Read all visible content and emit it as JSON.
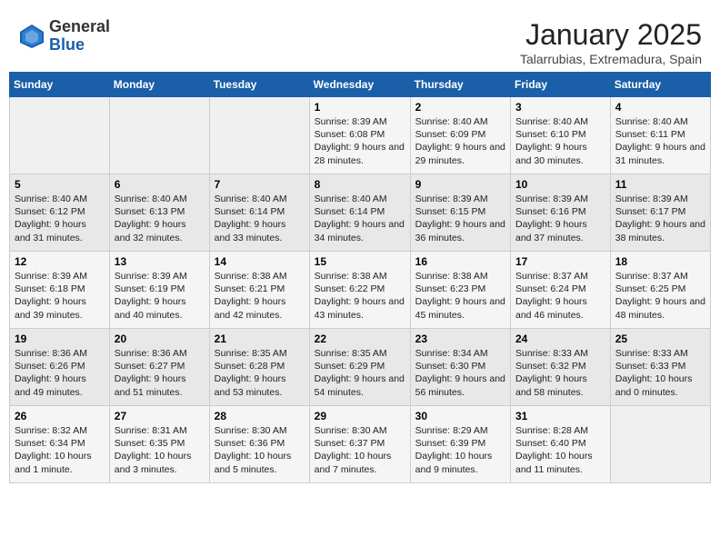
{
  "logo": {
    "general": "General",
    "blue": "Blue"
  },
  "title": "January 2025",
  "location": "Talarrubias, Extremadura, Spain",
  "weekdays": [
    "Sunday",
    "Monday",
    "Tuesday",
    "Wednesday",
    "Thursday",
    "Friday",
    "Saturday"
  ],
  "weeks": [
    [
      {
        "day": "",
        "info": ""
      },
      {
        "day": "",
        "info": ""
      },
      {
        "day": "",
        "info": ""
      },
      {
        "day": "1",
        "info": "Sunrise: 8:39 AM\nSunset: 6:08 PM\nDaylight: 9 hours and 28 minutes."
      },
      {
        "day": "2",
        "info": "Sunrise: 8:40 AM\nSunset: 6:09 PM\nDaylight: 9 hours and 29 minutes."
      },
      {
        "day": "3",
        "info": "Sunrise: 8:40 AM\nSunset: 6:10 PM\nDaylight: 9 hours and 30 minutes."
      },
      {
        "day": "4",
        "info": "Sunrise: 8:40 AM\nSunset: 6:11 PM\nDaylight: 9 hours and 31 minutes."
      }
    ],
    [
      {
        "day": "5",
        "info": "Sunrise: 8:40 AM\nSunset: 6:12 PM\nDaylight: 9 hours and 31 minutes."
      },
      {
        "day": "6",
        "info": "Sunrise: 8:40 AM\nSunset: 6:13 PM\nDaylight: 9 hours and 32 minutes."
      },
      {
        "day": "7",
        "info": "Sunrise: 8:40 AM\nSunset: 6:14 PM\nDaylight: 9 hours and 33 minutes."
      },
      {
        "day": "8",
        "info": "Sunrise: 8:40 AM\nSunset: 6:14 PM\nDaylight: 9 hours and 34 minutes."
      },
      {
        "day": "9",
        "info": "Sunrise: 8:39 AM\nSunset: 6:15 PM\nDaylight: 9 hours and 36 minutes."
      },
      {
        "day": "10",
        "info": "Sunrise: 8:39 AM\nSunset: 6:16 PM\nDaylight: 9 hours and 37 minutes."
      },
      {
        "day": "11",
        "info": "Sunrise: 8:39 AM\nSunset: 6:17 PM\nDaylight: 9 hours and 38 minutes."
      }
    ],
    [
      {
        "day": "12",
        "info": "Sunrise: 8:39 AM\nSunset: 6:18 PM\nDaylight: 9 hours and 39 minutes."
      },
      {
        "day": "13",
        "info": "Sunrise: 8:39 AM\nSunset: 6:19 PM\nDaylight: 9 hours and 40 minutes."
      },
      {
        "day": "14",
        "info": "Sunrise: 8:38 AM\nSunset: 6:21 PM\nDaylight: 9 hours and 42 minutes."
      },
      {
        "day": "15",
        "info": "Sunrise: 8:38 AM\nSunset: 6:22 PM\nDaylight: 9 hours and 43 minutes."
      },
      {
        "day": "16",
        "info": "Sunrise: 8:38 AM\nSunset: 6:23 PM\nDaylight: 9 hours and 45 minutes."
      },
      {
        "day": "17",
        "info": "Sunrise: 8:37 AM\nSunset: 6:24 PM\nDaylight: 9 hours and 46 minutes."
      },
      {
        "day": "18",
        "info": "Sunrise: 8:37 AM\nSunset: 6:25 PM\nDaylight: 9 hours and 48 minutes."
      }
    ],
    [
      {
        "day": "19",
        "info": "Sunrise: 8:36 AM\nSunset: 6:26 PM\nDaylight: 9 hours and 49 minutes."
      },
      {
        "day": "20",
        "info": "Sunrise: 8:36 AM\nSunset: 6:27 PM\nDaylight: 9 hours and 51 minutes."
      },
      {
        "day": "21",
        "info": "Sunrise: 8:35 AM\nSunset: 6:28 PM\nDaylight: 9 hours and 53 minutes."
      },
      {
        "day": "22",
        "info": "Sunrise: 8:35 AM\nSunset: 6:29 PM\nDaylight: 9 hours and 54 minutes."
      },
      {
        "day": "23",
        "info": "Sunrise: 8:34 AM\nSunset: 6:30 PM\nDaylight: 9 hours and 56 minutes."
      },
      {
        "day": "24",
        "info": "Sunrise: 8:33 AM\nSunset: 6:32 PM\nDaylight: 9 hours and 58 minutes."
      },
      {
        "day": "25",
        "info": "Sunrise: 8:33 AM\nSunset: 6:33 PM\nDaylight: 10 hours and 0 minutes."
      }
    ],
    [
      {
        "day": "26",
        "info": "Sunrise: 8:32 AM\nSunset: 6:34 PM\nDaylight: 10 hours and 1 minute."
      },
      {
        "day": "27",
        "info": "Sunrise: 8:31 AM\nSunset: 6:35 PM\nDaylight: 10 hours and 3 minutes."
      },
      {
        "day": "28",
        "info": "Sunrise: 8:30 AM\nSunset: 6:36 PM\nDaylight: 10 hours and 5 minutes."
      },
      {
        "day": "29",
        "info": "Sunrise: 8:30 AM\nSunset: 6:37 PM\nDaylight: 10 hours and 7 minutes."
      },
      {
        "day": "30",
        "info": "Sunrise: 8:29 AM\nSunset: 6:39 PM\nDaylight: 10 hours and 9 minutes."
      },
      {
        "day": "31",
        "info": "Sunrise: 8:28 AM\nSunset: 6:40 PM\nDaylight: 10 hours and 11 minutes."
      },
      {
        "day": "",
        "info": ""
      }
    ]
  ]
}
